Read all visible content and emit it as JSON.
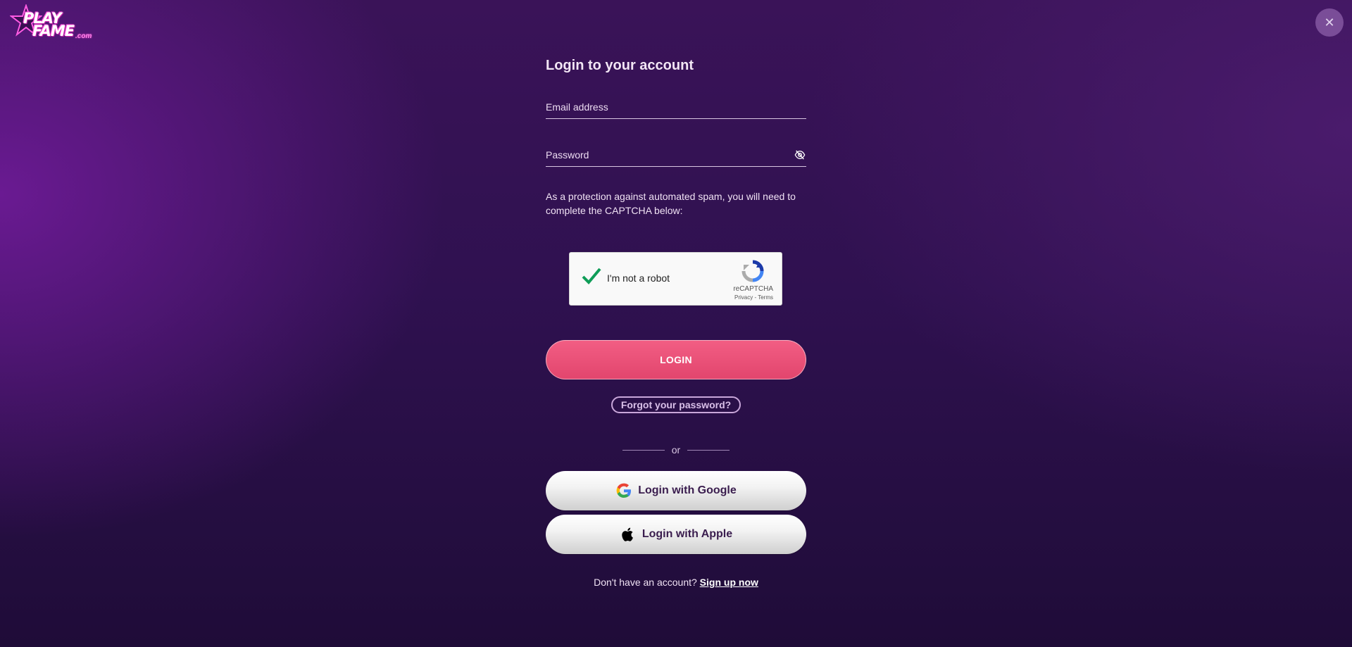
{
  "header": {
    "logo": {
      "word1": "PLAY",
      "word2": "FAME",
      "suffix": ".com",
      "icon": "star-logo-icon"
    },
    "close_icon": "close-icon",
    "close_glyph": "✕"
  },
  "form": {
    "title": "Login to your account",
    "email_placeholder": "Email address",
    "password_placeholder": "Password",
    "password_toggle_icon": "eye-slash-icon",
    "captcha_note": "As a protection against automated spam, you will need to complete the CAPTCHA below:",
    "recaptcha": {
      "checkbox_label": "I'm not a robot",
      "brand": "reCAPTCHA",
      "privacy": "Privacy",
      "separator": "-",
      "terms": "Terms",
      "checked": true
    },
    "login_label": "LOGIN",
    "forgot_label": "Forgot your password?",
    "or_label": "or",
    "google_label": "Login with Google",
    "apple_label": "Login with Apple",
    "signup_prompt": "Don't have an account?",
    "signup_link": "Sign up now"
  },
  "colors": {
    "accent": "#e9506f",
    "background": "#2f1150",
    "close_bg": "#7a4d98"
  }
}
